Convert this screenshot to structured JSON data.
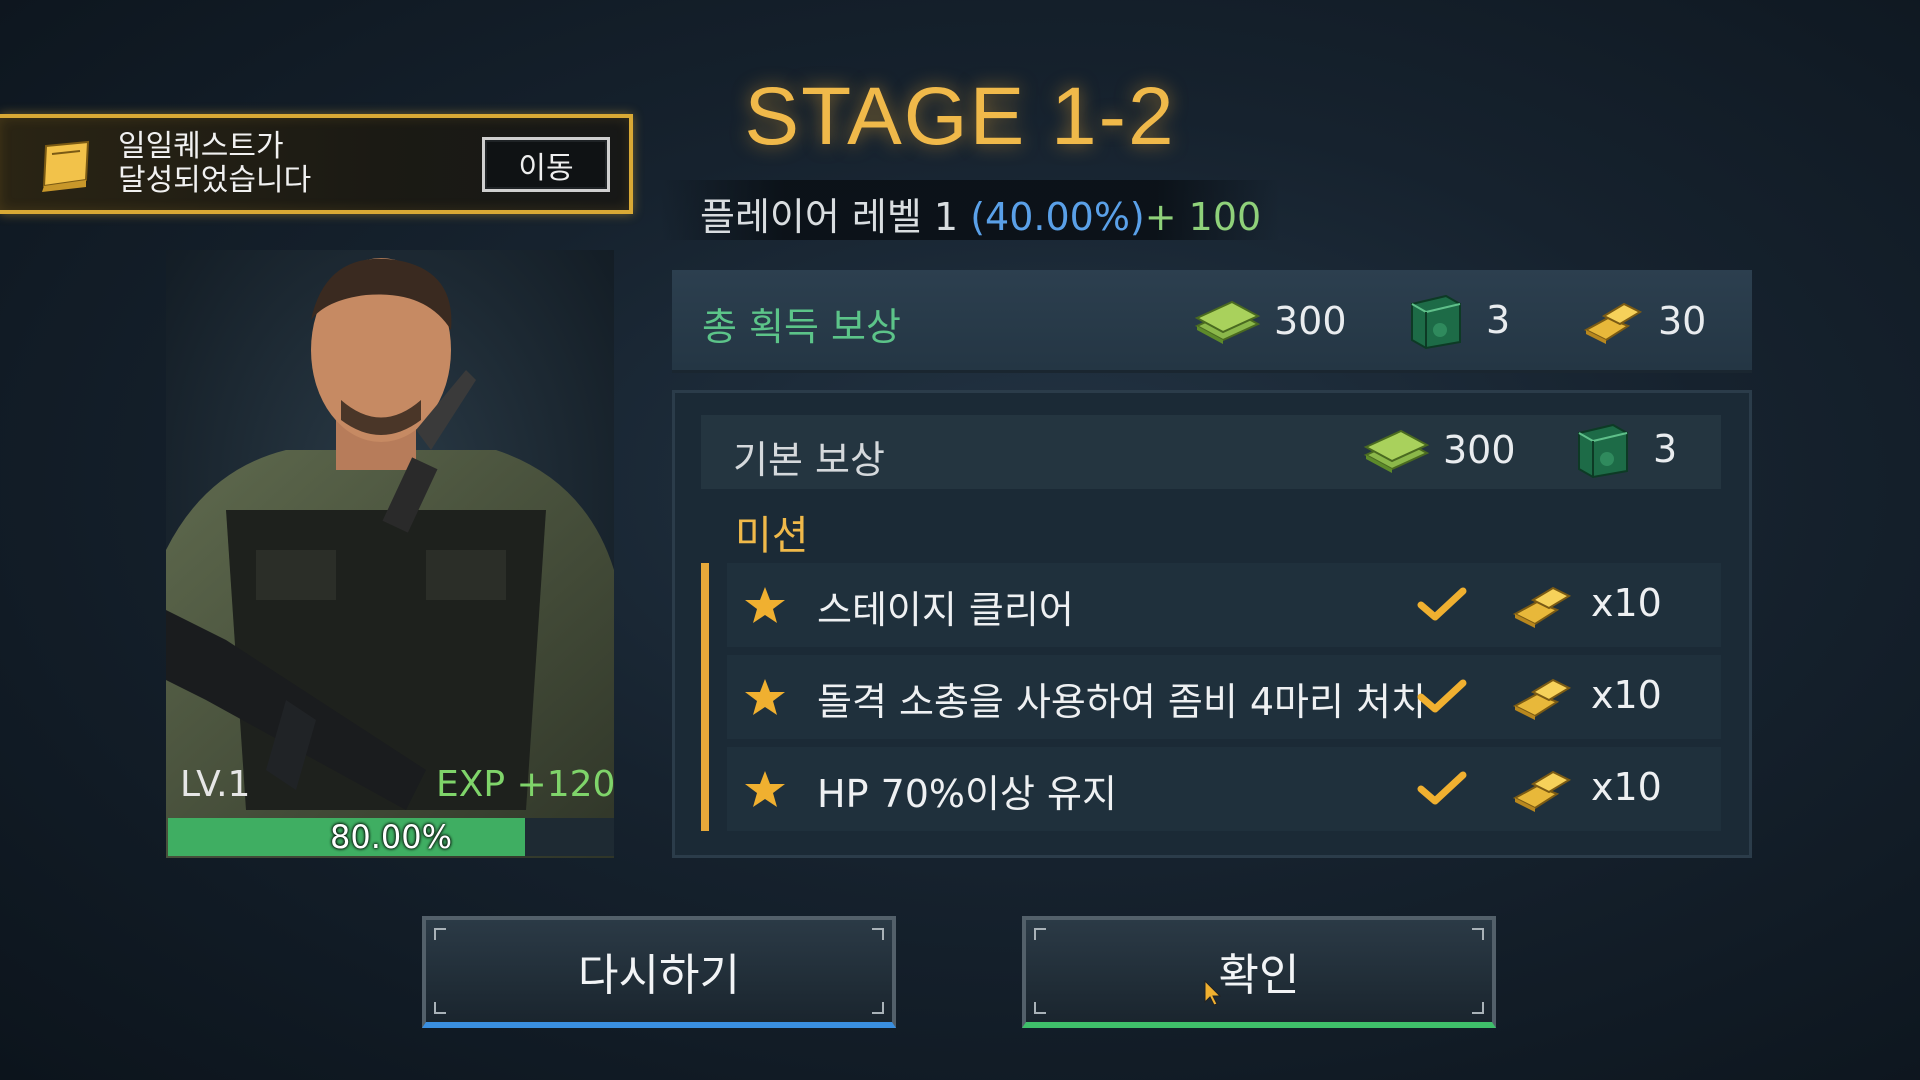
{
  "quest_notice": {
    "text_line1": "일일퀘스트가",
    "text_line2": "달성되었습니다",
    "move_label": "이동"
  },
  "stage": {
    "title": "STAGE 1-2"
  },
  "player_level": {
    "label": "플레이어 레벨 1",
    "percent": "(40.00%)",
    "bonus": "+ 100"
  },
  "character": {
    "level": "LV.1",
    "exp_gain": "EXP +120",
    "exp_percent_text": "80.00%",
    "exp_fraction": 0.8
  },
  "total_reward": {
    "label": "총 획득 보상",
    "cash": "300",
    "box": "3",
    "gold": "30"
  },
  "base_reward": {
    "label": "기본 보상",
    "cash": "300",
    "box": "3"
  },
  "missions": {
    "label": "미션",
    "items": [
      {
        "text": "스테이지 클리어",
        "reward": "x10"
      },
      {
        "text": "돌격 소총을 사용하여 좀비 4마리 처치",
        "reward": "x10"
      },
      {
        "text": "HP 70%이상 유지",
        "reward": "x10"
      }
    ]
  },
  "buttons": {
    "retry": "다시하기",
    "confirm": "확인"
  },
  "colors": {
    "accent_gold": "#f0b94a",
    "accent_green": "#5cc489",
    "exp_bar": "#3fae62",
    "percent_blue": "#5aa0e8"
  },
  "icons": [
    "book-icon",
    "cash-stack-icon",
    "supply-box-icon",
    "gold-bar-icon",
    "star-icon",
    "check-icon",
    "cursor-icon"
  ]
}
